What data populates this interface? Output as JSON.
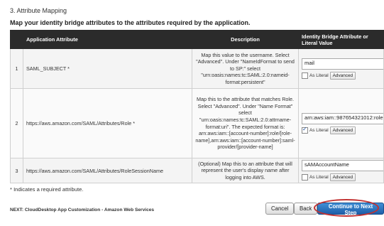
{
  "section_title": "3. Attribute Mapping",
  "subtitle": "Map your identity bridge attributes to the attributes required by the application.",
  "table": {
    "headers": {
      "app_attr": "Application Attribute",
      "desc": "Description",
      "idb": "Identity Bridge Attribute or Literal Value"
    },
    "rows": [
      {
        "num": "1",
        "attr": "SAML_SUBJECT *",
        "desc": "Map this value to the username. Select \"Advanced\". Under \"NameIdFormat to send to SP:\" select \"urn:oasis:names:tc:SAML:2.0:nameid-format:persistent\"",
        "value": "mail",
        "as_literal": "As Literal",
        "advanced": "Advanced",
        "literal_checked": false
      },
      {
        "num": "2",
        "attr": "https://aws.amazon.com/SAML/Attributes/Role *",
        "desc": "Map this to the attribute that matches Role. Select \"Advanced\". Under \"Name Format\" select \"urn:oasis:names:tc:SAML:2.0:attrname-format:uri\". The expected format is: arn:aws:iam::[account-number]:role/[role-name],arn:aws:iam::[account-number]:saml-provider/[provider-name]",
        "value": "arn:aws:iam::987654321012:role",
        "as_literal": "As Literal",
        "advanced": "Advanced",
        "literal_checked": true
      },
      {
        "num": "3",
        "attr": "https://aws.amazon.com/SAML/Attributes/RoleSessionName",
        "desc": "(Optional) Map this to an attribute that will represent the user's display name after logging into AWS.",
        "value": "sAMAccountName",
        "as_literal": "As Literal",
        "advanced": "Advanced",
        "literal_checked": false
      }
    ]
  },
  "required_note": "* Indicates a required attribute.",
  "next_label": "NEXT: CloudDesktop App Customization - Amazon Web Services",
  "buttons": {
    "cancel": "Cancel",
    "back": "Back",
    "next": "Continue to Next Step"
  },
  "colors": {
    "header_bg": "#2b2b2b",
    "primary_button": "#2a73c0",
    "highlight_circle": "#c23232"
  }
}
